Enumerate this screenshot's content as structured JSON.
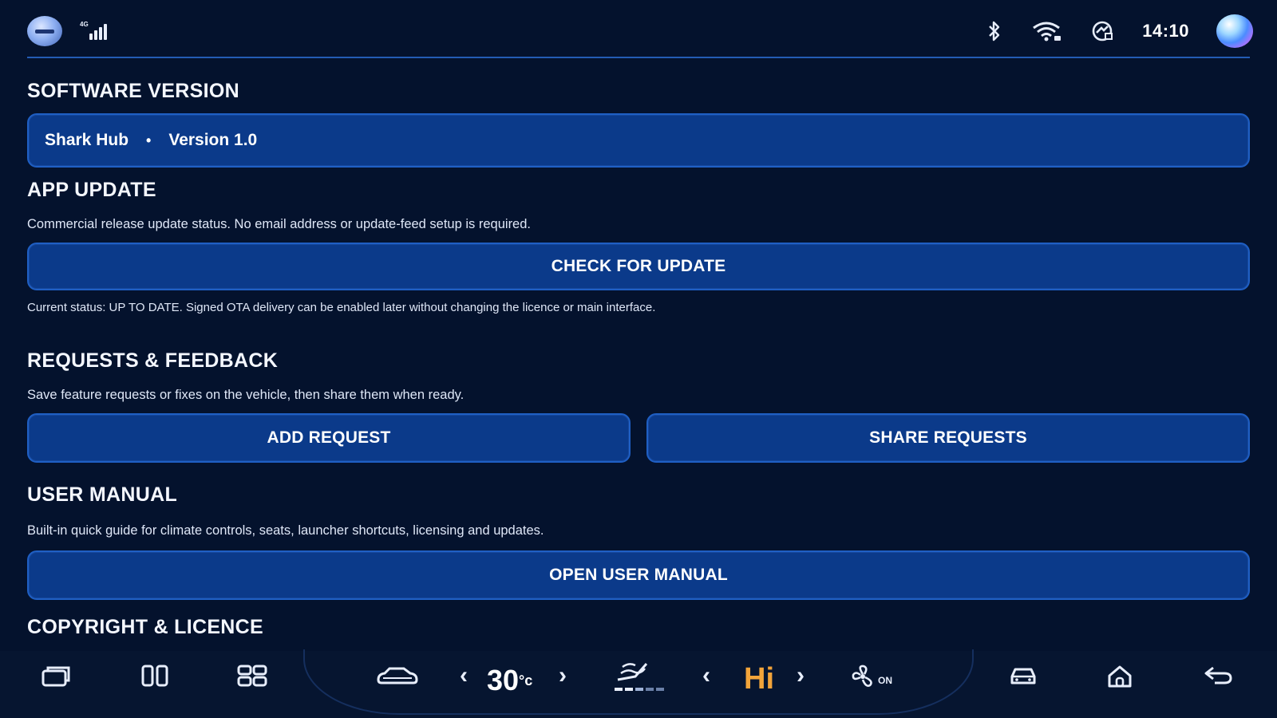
{
  "status_bar": {
    "network_label": "4G",
    "time": "14:10",
    "icons": [
      "app-badge-icon",
      "signal-icon",
      "bluetooth-icon",
      "wifi-icon",
      "hotspot-icon",
      "assistant-icon"
    ]
  },
  "software_version": {
    "title": "SOFTWARE VERSION",
    "app_name": "Shark Hub",
    "separator": "•",
    "version": "Version 1.0"
  },
  "app_update": {
    "title": "APP UPDATE",
    "description": "Commercial release update status. No email address or update-feed setup is required.",
    "button_label": "CHECK FOR UPDATE",
    "status_note": "Current status: UP TO DATE. Signed OTA delivery can be enabled later without changing the licence or main interface."
  },
  "requests": {
    "title": "REQUESTS & FEEDBACK",
    "description": "Save feature requests or fixes on the vehicle, then share them when ready.",
    "add_button_label": "ADD REQUEST",
    "share_button_label": "SHARE REQUESTS"
  },
  "user_manual": {
    "title": "USER MANUAL",
    "description": "Built-in quick guide for climate controls, seats, launcher shortcuts, licensing and updates.",
    "button_label": "OPEN USER MANUAL"
  },
  "copyright": {
    "title": "COPYRIGHT & LICENCE"
  },
  "dock": {
    "temperature": "30",
    "temperature_unit": "°c",
    "fan_level": "Hi",
    "fan_status": "ON",
    "prev_chevron": "‹",
    "next_chevron": "›",
    "colors": {
      "fan_level": "#f2a43a",
      "accent": "#1f5fc4"
    }
  }
}
